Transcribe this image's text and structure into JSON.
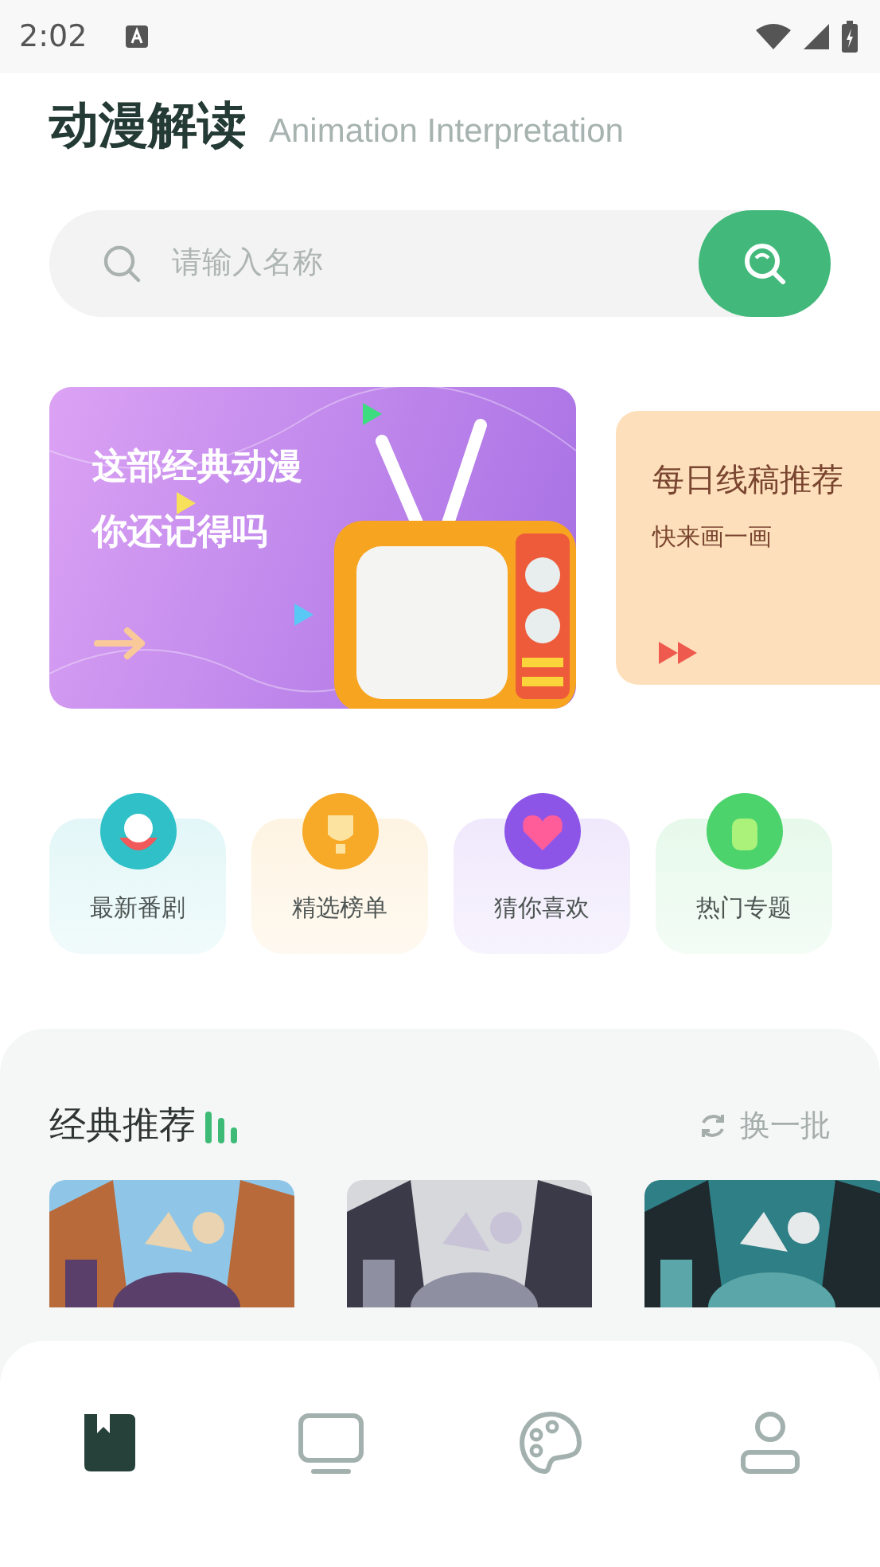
{
  "status_bar": {
    "time": "2:02"
  },
  "header": {
    "title": "动漫解读",
    "subtitle": "Animation Interpretation"
  },
  "search": {
    "placeholder": "请输入名称"
  },
  "banners": [
    {
      "kind": "purple",
      "lines": [
        "这部经典动漫",
        "你还记得吗"
      ]
    },
    {
      "kind": "peach",
      "lines": [
        "每日线稿推荐",
        "快来画一画"
      ]
    }
  ],
  "categories": [
    {
      "label": "最新番剧",
      "color": "#2fc0c8"
    },
    {
      "label": "精选榜单",
      "color": "#f7a928"
    },
    {
      "label": "猜你喜欢",
      "color": "#8c55e8"
    },
    {
      "label": "热门专题",
      "color": "#4cd36c"
    }
  ],
  "section": {
    "title": "经典推荐",
    "refresh": "换一批"
  },
  "bottom_nav": [
    {
      "selected": true
    },
    {
      "selected": false
    },
    {
      "selected": false
    },
    {
      "selected": false
    }
  ]
}
